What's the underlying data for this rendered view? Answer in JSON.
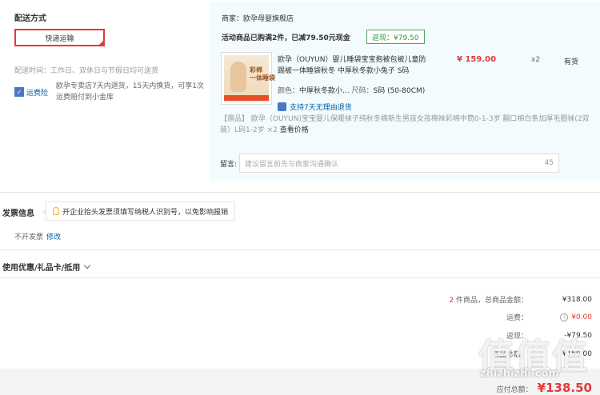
{
  "shipping": {
    "title": "配送方式",
    "method": "快递运输",
    "time": "配送时间：工作日、双休日与节假日均可送货",
    "insurance_label": "运费险",
    "insurance_text": "欧孕专卖店7天内退货，15天内换货，可享1次运费赔付到小金库"
  },
  "shop": {
    "name": "商家：欧孕母婴旗舰店",
    "promo": "活动商品已购满2件，已减79.50元现金",
    "rebate": "返现：¥79.50",
    "thumb_text": "彩棉\n一体睡袋",
    "product_name": "欧孕（OUYUN）婴儿睡袋宝宝抱被包被儿童防踢被一体睡袋秋冬 中厚秋冬款小兔子 S码",
    "attr_color_label": "颜色：",
    "attr_color": "中厚秋冬款小...",
    "attr_size_label": "尺码：",
    "attr_size": "S码 (50-80CM)",
    "price": "¥ 159.00",
    "qty": "x2",
    "stock": "有货",
    "return_policy": "支持7天无理由退货",
    "gift_tag": "【赠品】",
    "gift_text": "欧孕（OUYUN)宝宝婴儿保暖袜子纯秋冬棉新生男孩女孩棉袜彩棉中筒0-1-3岁 翻口棉白条加厚毛圈袜(2双装）L码1-2岁 ×2",
    "gift_view": "查看价格",
    "note_label": "留言:",
    "note_placeholder": "建议留言前先与商家沟通确认",
    "note_count": "45"
  },
  "invoice": {
    "title": "发票信息",
    "tip": "开企业抬头发票须填写纳税人识别号，以免影响报销",
    "value": "不开发票",
    "edit": "修改"
  },
  "coupon": {
    "title": "使用优惠/礼品卡/抵用"
  },
  "totals": {
    "count": "2",
    "count_label": " 件商品，总商品金额：",
    "goods_amount": "¥318.00",
    "shipping_label": "运费：",
    "shipping_amount": "¥0.00",
    "discount_label": "返现：",
    "discount_amount": "-¥79.50",
    "subtotal_label": "商品总额：",
    "subtotal_amount": "¥159.00",
    "due_label": "应付总额：",
    "due_amount": "¥138.50"
  },
  "watermark": {
    "big": "值值值",
    "small": "zhizhizhi.com"
  }
}
